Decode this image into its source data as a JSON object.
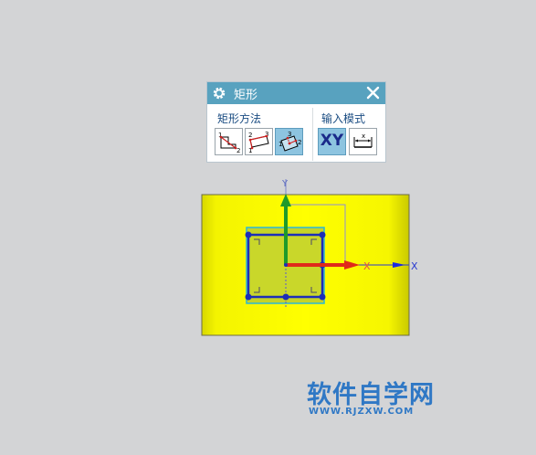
{
  "dialog": {
    "title": "矩形",
    "group_method": "矩形方法",
    "group_input": "输入模式",
    "xy_label": "XY",
    "icons": [
      "gear-icon",
      "close-icon",
      "rect-2point-icon",
      "rect-3point-icon",
      "rect-from-center-icon",
      "xy-mode-icon",
      "parameter-mode-icon"
    ]
  },
  "viewport": {
    "axis_x_label": "X",
    "axis_x2_label": "X",
    "axis_y_label": "Y",
    "dim_label": "x"
  },
  "watermark": {
    "main": "软件自学网",
    "sub": "WWW.RJZXW.COM"
  },
  "colors": {
    "background": "#d3d4d6",
    "header": "#58a2bf",
    "solid_face": "#f5f500",
    "sketch_rect": "#1c2eb8",
    "x_axis": "#e02a1a",
    "y_axis": "#1f9a2a",
    "watermark": "#2f78c5"
  }
}
